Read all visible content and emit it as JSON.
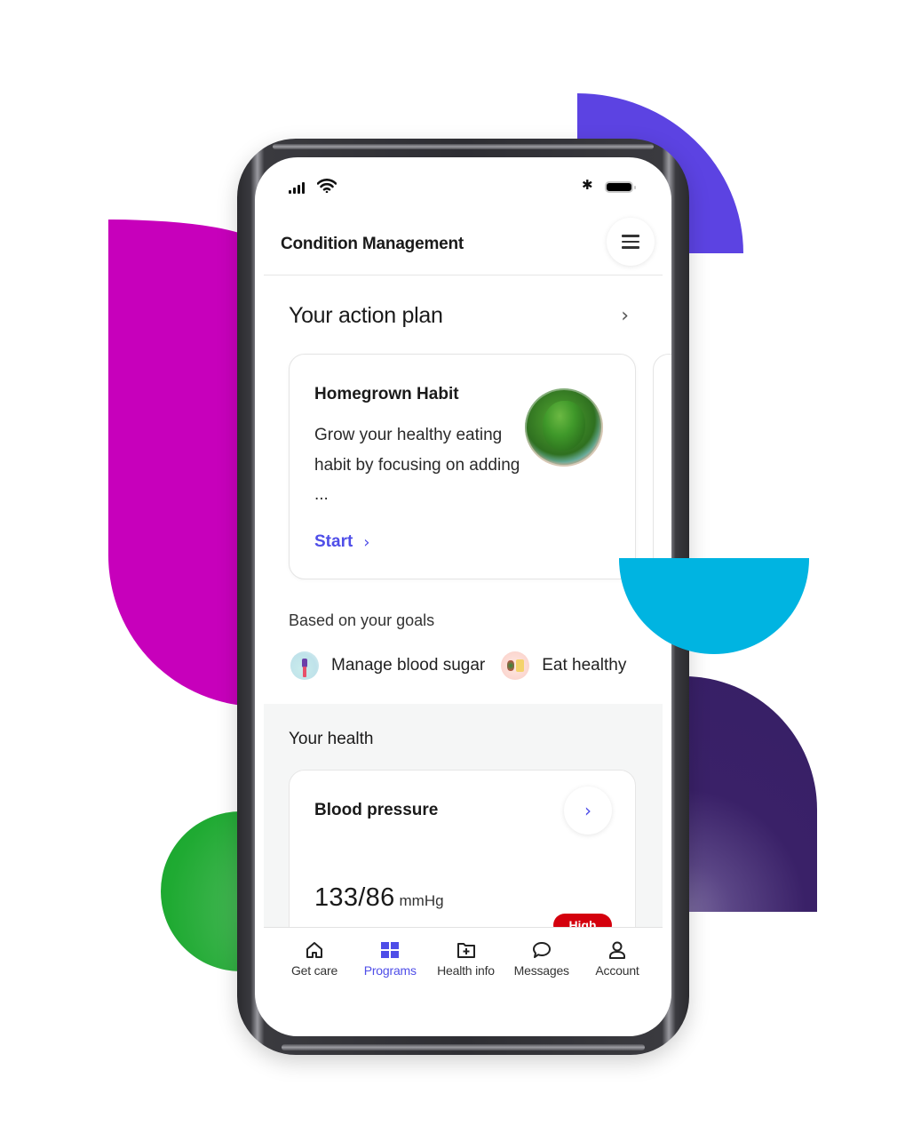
{
  "colors": {
    "accent": "#4f4ee8",
    "alert_red": "#d4000d",
    "magenta": "#c700bb",
    "violet": "#5c43e2",
    "cyan": "#00b4e1",
    "indigo": "#371f66",
    "green": "#1faa32"
  },
  "status_bar": {
    "icons": [
      "signal-icon",
      "wifi-icon",
      "bluetooth-icon",
      "battery-icon"
    ],
    "bluetooth_glyph": "✱"
  },
  "header": {
    "title": "Condition Management",
    "menu_icon": "hamburger-menu-icon"
  },
  "action_plan": {
    "heading": "Your action plan",
    "chevron": "›",
    "card": {
      "title": "Homegrown Habit",
      "description": "Grow your healthy eating habit by focusing on adding ...",
      "image": "spinach-bowl-image",
      "cta_label": "Start",
      "cta_chevron": "›"
    }
  },
  "goals": {
    "heading": "Based on your goals",
    "items": [
      {
        "label": "Manage blood sugar",
        "icon": "blood-sugar-illustration-icon"
      },
      {
        "label": "Eat healthy",
        "icon": "healthy-food-illustration-icon"
      }
    ]
  },
  "health": {
    "heading": "Your health",
    "card": {
      "title": "Blood pressure",
      "chevron": "›",
      "value": "133/86",
      "unit": "mmHg",
      "badge": "High"
    }
  },
  "bottom_nav": {
    "items": [
      {
        "label": "Get care",
        "icon": "home-icon",
        "active": false
      },
      {
        "label": "Programs",
        "icon": "grid-icon",
        "active": true
      },
      {
        "label": "Health info",
        "icon": "folder-plus-icon",
        "active": false
      },
      {
        "label": "Messages",
        "icon": "chat-bubble-icon",
        "active": false
      },
      {
        "label": "Account",
        "icon": "user-icon",
        "active": false
      }
    ]
  }
}
